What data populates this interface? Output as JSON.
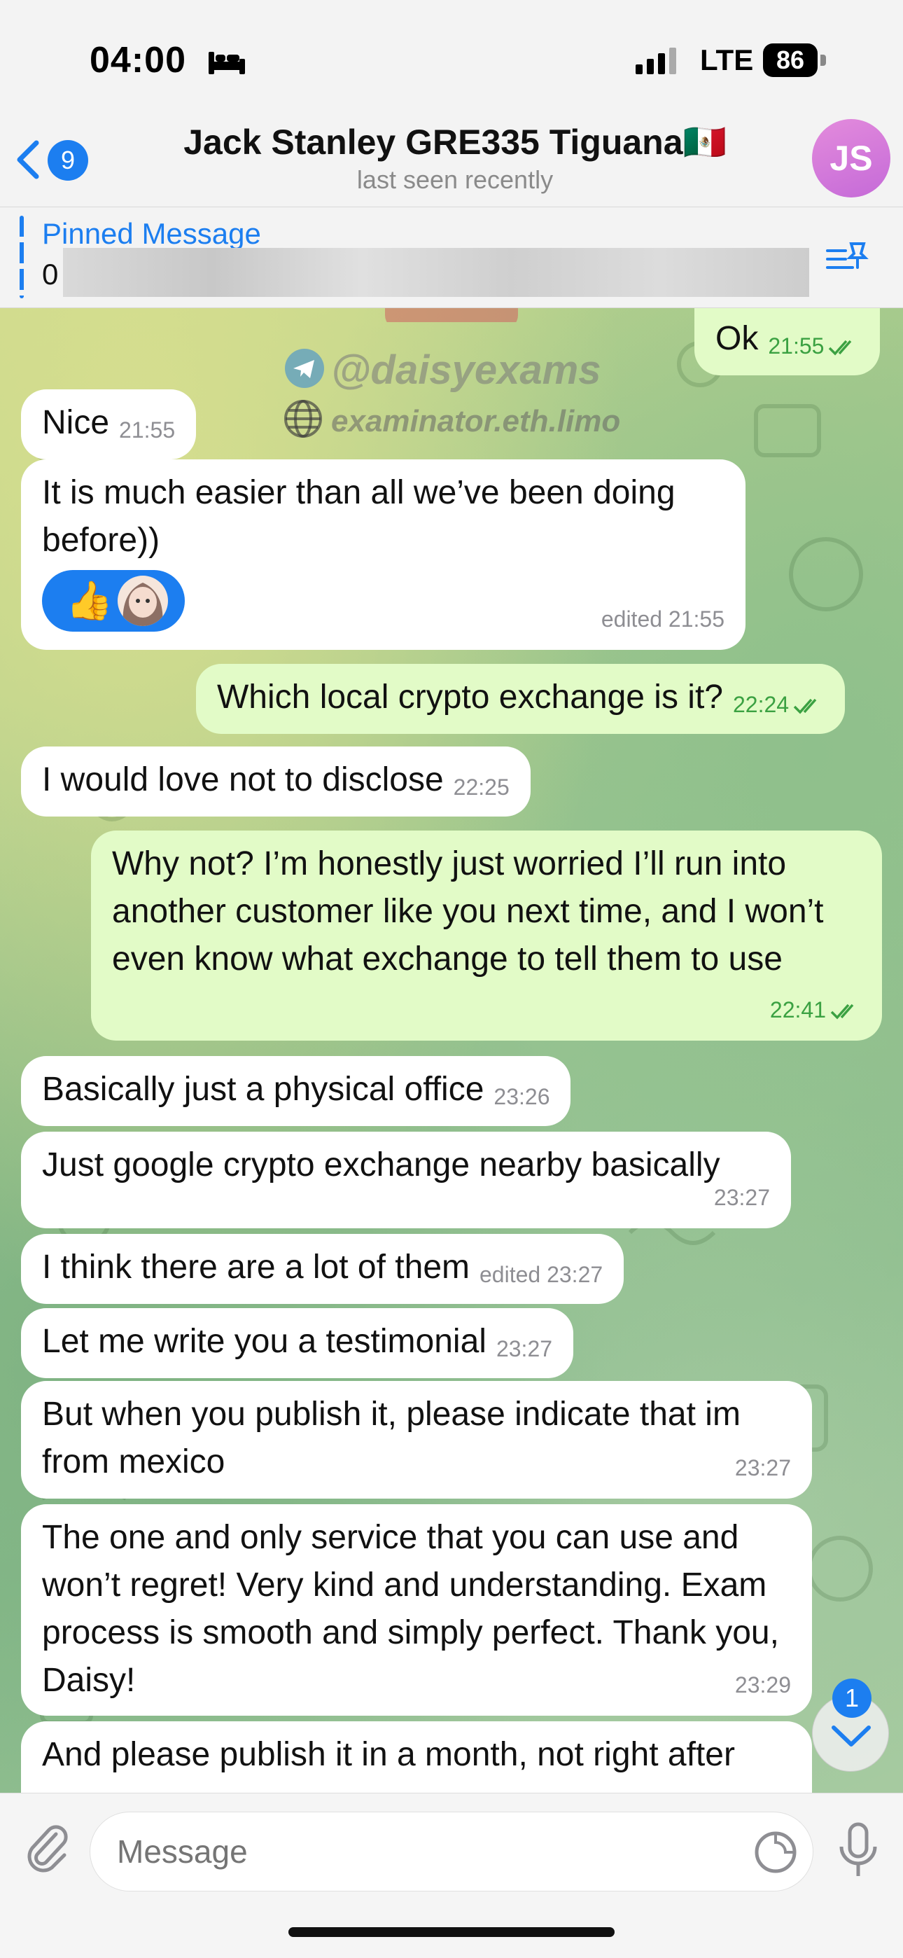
{
  "status_bar": {
    "time": "04:00",
    "network": "LTE",
    "battery": "86",
    "battery_level_pct": 86
  },
  "header": {
    "back_badge": "9",
    "title": "Jack Stanley GRE335 Tiguana🇲🇽",
    "subtitle": "last seen recently",
    "avatar_initials": "JS"
  },
  "pinned": {
    "title": "Pinned Message",
    "text": "0"
  },
  "watermark": {
    "handle": "@daisyexams",
    "site": "examinator.eth.limo"
  },
  "messages": [
    {
      "dir": "out",
      "text": "Ok",
      "time": "21:55"
    },
    {
      "dir": "in",
      "text": "Nice",
      "time": "21:55"
    },
    {
      "dir": "in",
      "text": "It is much easier than all we’ve been doing before))",
      "time": "edited 21:55",
      "reaction": "👍"
    },
    {
      "dir": "out",
      "text": "Which local crypto exchange is it?",
      "time": "22:24"
    },
    {
      "dir": "in",
      "text": "I would love not to disclose",
      "time": "22:25"
    },
    {
      "dir": "out",
      "text": "Why not? I’m honestly just worried I’ll run into another customer like you next time, and I won’t even know what exchange to tell them to use",
      "time": "22:41"
    },
    {
      "dir": "in",
      "text": "Basically just a physical office",
      "time": "23:26"
    },
    {
      "dir": "in",
      "text": "Just google crypto exchange nearby basically",
      "time": "23:27"
    },
    {
      "dir": "in",
      "text": "I think there are a lot of them",
      "time": "edited 23:27"
    },
    {
      "dir": "in",
      "text": "Let me write you a testimonial",
      "time": "23:27"
    },
    {
      "dir": "in",
      "text": "But when you publish it, please indicate that im from mexico",
      "time": "23:27"
    },
    {
      "dir": "in",
      "text": "The one and only service that you can use and won’t regret! Very kind and understanding. Exam process is smooth and simply perfect. Thank you, Daisy!",
      "time": "23:29"
    },
    {
      "dir": "in",
      "text": "And please publish it in a month, not right after",
      "time": ""
    }
  ],
  "scroll_down": {
    "unread": "1"
  },
  "composer": {
    "placeholder": "Message"
  },
  "colors": {
    "accent": "#1c7ef0",
    "outgoing_bubble": "#e2fbc7",
    "incoming_bubble": "#ffffff",
    "avatar": "#d47cd9"
  }
}
